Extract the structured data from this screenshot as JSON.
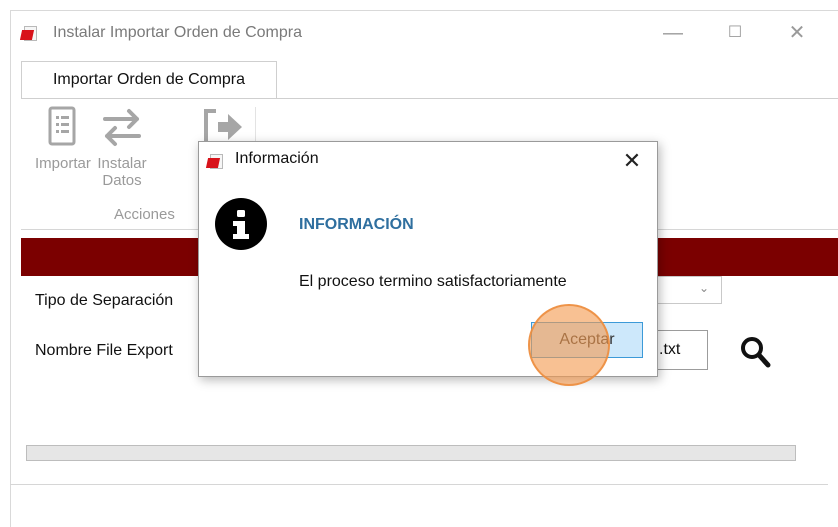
{
  "window": {
    "title": "Instalar Importar Orden de Compra",
    "controls": {
      "minimize": "—",
      "maximize": "☐",
      "close": "✕"
    }
  },
  "tabs": [
    {
      "label": "Importar Orden de Compra",
      "active": true
    }
  ],
  "ribbon": {
    "buttons": [
      {
        "label": "Importar",
        "icon": "document-list-icon"
      },
      {
        "label": "Instalar\nDatos",
        "icon": "swap-arrows-icon"
      },
      {
        "label": "",
        "icon": "exit-arrow-icon"
      }
    ],
    "group_label": "Acciones"
  },
  "form": {
    "separation_label": "Tipo de Separación",
    "export_label": "Nombre File Export",
    "export_value": ".txt",
    "search_icon": "magnifier-icon"
  },
  "progress": {
    "value": 0
  },
  "dialog": {
    "title": "Información",
    "close": "✕",
    "heading": "INFORMACIÓN",
    "message": "El proceso termino satisfactoriamente",
    "ok_label": "Aceptar",
    "icon": "info-icon"
  },
  "colors": {
    "banner": "#7b0000",
    "heading": "#2f6f9f",
    "ok_button_bg": "#cde8fb",
    "ok_button_border": "#3c9ad8",
    "click_highlight": "#f39b50",
    "brand_red": "#d8121a"
  }
}
